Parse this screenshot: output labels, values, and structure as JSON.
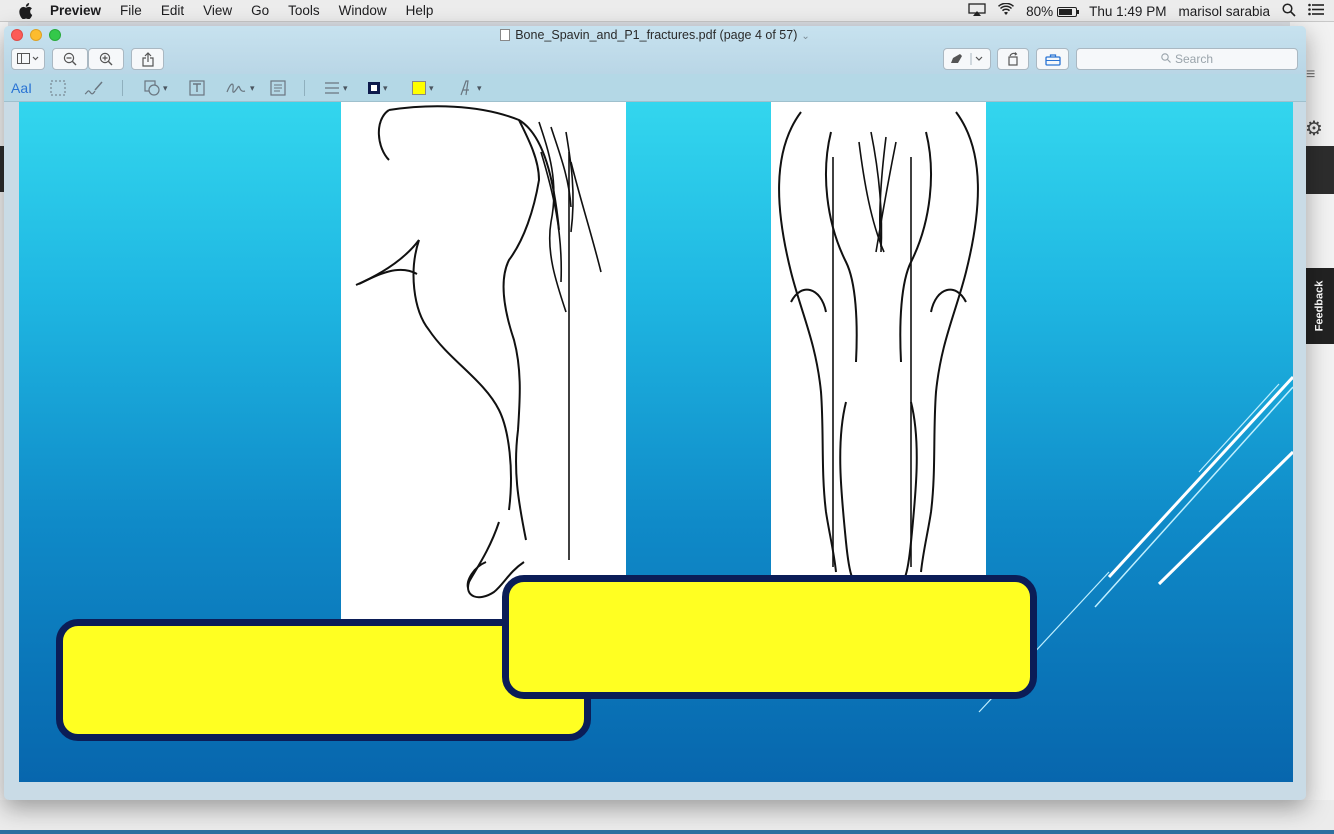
{
  "menubar": {
    "app_name": "Preview",
    "items": [
      "File",
      "Edit",
      "View",
      "Go",
      "Tools",
      "Window",
      "Help"
    ],
    "battery": "80%",
    "clock": "Thu 1:49 PM",
    "user": "marisol sarabia"
  },
  "window": {
    "title": "Bone_Spavin_and_P1_fractures.pdf (page 4 of 57)",
    "search_placeholder": "Search",
    "markup_text_tool": "AaI"
  },
  "background_app": {
    "feedback_label": "Feedback"
  },
  "colors": {
    "slide_top": "#33d6ee",
    "slide_bottom": "#0766ad",
    "box_fill": "#ffff22",
    "box_border": "#0b1d57"
  }
}
